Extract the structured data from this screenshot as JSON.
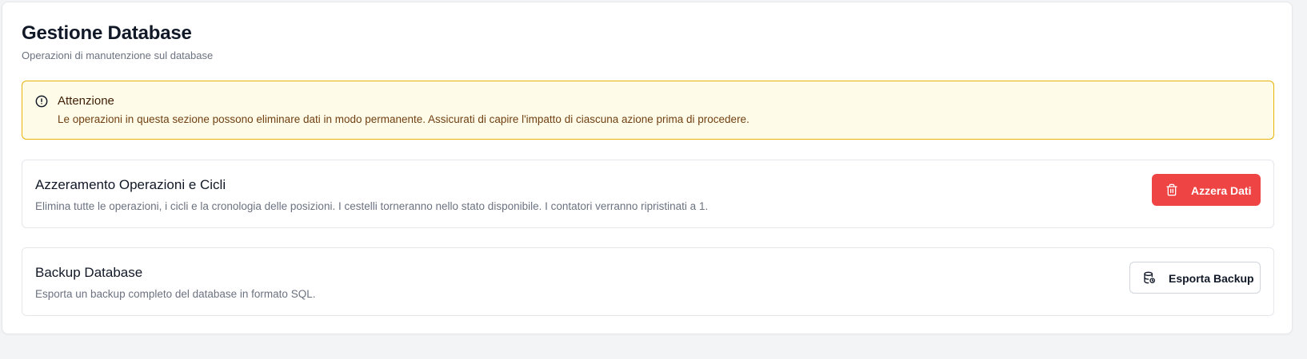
{
  "page": {
    "title": "Gestione Database",
    "subtitle": "Operazioni di manutenzione sul database"
  },
  "alert": {
    "icon": "alert-circle-icon",
    "title": "Attenzione",
    "message": "Le operazioni in questa sezione possono eliminare dati in modo permanente. Assicurati di capire l'impatto di ciascuna azione prima di procedere.",
    "colors": {
      "background": "#fefce8",
      "border": "#eab308",
      "text": "#713f12"
    }
  },
  "sections": [
    {
      "title": "Azzeramento Operazioni e Cicli",
      "description": "Elimina tutte le operazioni, i cicli e la cronologia delle posizioni. I cestelli torneranno nello stato disponibile. I contatori verranno ripristinati a 1.",
      "button": {
        "label": "Azzera Dati",
        "icon": "trash-icon",
        "color": "#ef4444"
      }
    },
    {
      "title": "Backup Database",
      "description": "Esporta un backup completo del database in formato SQL.",
      "button": {
        "label": "Esporta Backup",
        "icon": "database-backup-icon"
      }
    }
  ]
}
